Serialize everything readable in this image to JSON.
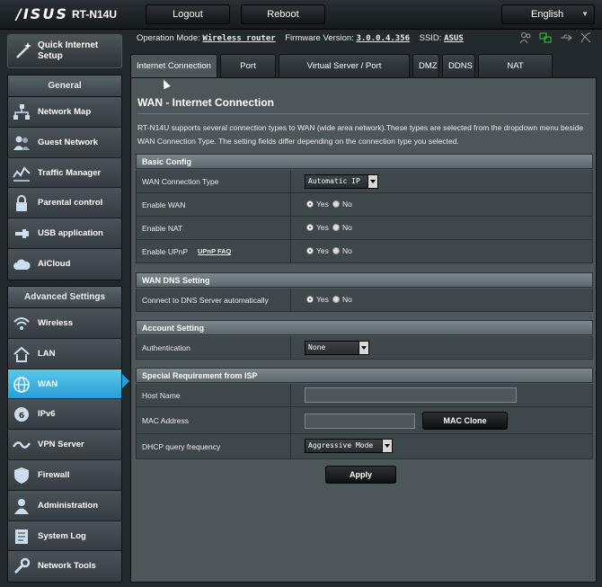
{
  "header": {
    "logo": "/ISUS",
    "model": "RT-N14U",
    "logout_label": "Logout",
    "reboot_label": "Reboot",
    "language": "English"
  },
  "quick_setup": {
    "label_line1": "Quick Internet",
    "label_line2": "Setup"
  },
  "sidebar": {
    "general_title": "General",
    "general_items": [
      {
        "label": "Network Map",
        "icon": "network-map-icon"
      },
      {
        "label": "Guest Network",
        "icon": "guest-network-icon"
      },
      {
        "label": "Traffic Manager",
        "icon": "traffic-manager-icon"
      },
      {
        "label": "Parental control",
        "icon": "parental-control-icon"
      },
      {
        "label": "USB application",
        "icon": "usb-icon"
      },
      {
        "label": "AiCloud",
        "icon": "cloud-icon"
      }
    ],
    "advanced_title": "Advanced Settings",
    "advanced_items": [
      {
        "label": "Wireless",
        "icon": "wireless-icon"
      },
      {
        "label": "LAN",
        "icon": "lan-home-icon"
      },
      {
        "label": "WAN",
        "icon": "globe-icon",
        "active": true
      },
      {
        "label": "IPv6",
        "icon": "ipv6-icon"
      },
      {
        "label": "VPN Server",
        "icon": "vpn-icon"
      },
      {
        "label": "Firewall",
        "icon": "firewall-shield-icon"
      },
      {
        "label": "Administration",
        "icon": "administration-icon"
      },
      {
        "label": "System Log",
        "icon": "system-log-icon"
      },
      {
        "label": "Network Tools",
        "icon": "network-tools-icon"
      }
    ]
  },
  "info": {
    "op_mode_label": "Operation Mode:",
    "op_mode_value": "Wireless router",
    "firmware_label": "Firmware Version:",
    "firmware_value": "3.0.0.4.356",
    "ssid_label": "SSID:",
    "ssid_value": "ASUS"
  },
  "tabs": [
    {
      "label": "Internet Connection",
      "active": true
    },
    {
      "label": "Port Trigger"
    },
    {
      "label": "Virtual Server / Port Forwarding"
    },
    {
      "label": "DMZ"
    },
    {
      "label": "DDNS"
    },
    {
      "label": "NAT Passthrough"
    }
  ],
  "page": {
    "title": "WAN - Internet Connection",
    "description": "RT-N14U supports several connection types to WAN (wide area network).These types are selected from the dropdown menu beside WAN Connection Type. The setting fields differ depending on the connection type you selected."
  },
  "basic_config": {
    "title": "Basic Config",
    "wan_type_label": "WAN Connection Type",
    "wan_type_value": "Automatic IP",
    "enable_wan_label": "Enable WAN",
    "enable_nat_label": "Enable NAT",
    "enable_upnp_label": "Enable UPnP",
    "upnp_faq": "UPnP  FAQ",
    "yes": "Yes",
    "no": "No"
  },
  "dns": {
    "title": "WAN DNS Setting",
    "auto_label": "Connect to DNS Server automatically"
  },
  "account": {
    "title": "Account Setting",
    "auth_label": "Authentication",
    "auth_value": "None"
  },
  "isp": {
    "title": "Special Requirement from ISP",
    "host_label": "Host Name",
    "host_value": "",
    "mac_label": "MAC Address",
    "mac_value": "",
    "mac_clone_label": "MAC Clone",
    "dhcp_label": "DHCP query frequency",
    "dhcp_value": "Aggressive Mode"
  },
  "apply_label": "Apply"
}
